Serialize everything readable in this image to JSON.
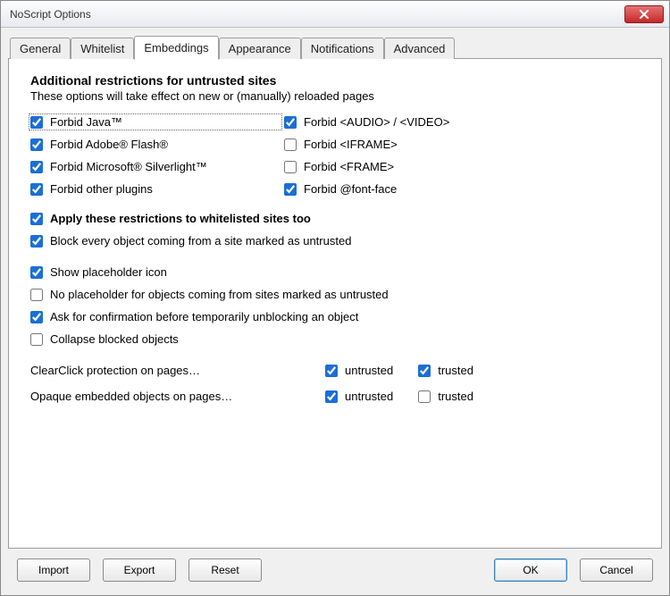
{
  "window": {
    "title": "NoScript Options"
  },
  "tabs": [
    "General",
    "Whitelist",
    "Embeddings",
    "Appearance",
    "Notifications",
    "Advanced"
  ],
  "panel": {
    "heading": "Additional restrictions for untrusted sites",
    "subheading": "These options will take effect on new or (manually) reloaded pages",
    "forbid": {
      "java": {
        "label": "Forbid Java™",
        "checked": true
      },
      "audio_video": {
        "label": "Forbid <AUDIO> / <VIDEO>",
        "checked": true
      },
      "flash": {
        "label": "Forbid Adobe® Flash®",
        "checked": true
      },
      "iframe": {
        "label": "Forbid <IFRAME>",
        "checked": false
      },
      "silverlight": {
        "label": "Forbid Microsoft® Silverlight™",
        "checked": true
      },
      "frame": {
        "label": "Forbid <FRAME>",
        "checked": false
      },
      "other_plugins": {
        "label": "Forbid other plugins",
        "checked": true
      },
      "font_face": {
        "label": "Forbid @font-face",
        "checked": true
      }
    },
    "options": {
      "apply_whitelisted": {
        "label": "Apply these restrictions to whitelisted sites too",
        "checked": true
      },
      "block_untrusted": {
        "label": "Block every object coming from a site marked as untrusted",
        "checked": true
      },
      "show_placeholder": {
        "label": "Show placeholder icon",
        "checked": true
      },
      "no_placeholder_untrusted": {
        "label": "No placeholder for objects coming from sites marked as untrusted",
        "checked": false
      },
      "ask_confirmation": {
        "label": "Ask for confirmation before temporarily unblocking an object",
        "checked": true
      },
      "collapse_blocked": {
        "label": "Collapse blocked objects",
        "checked": false
      }
    },
    "rows": {
      "clearclick": {
        "label": "ClearClick protection on pages…",
        "untrusted": {
          "label": "untrusted",
          "checked": true
        },
        "trusted": {
          "label": "trusted",
          "checked": true
        }
      },
      "opaque": {
        "label": "Opaque embedded objects on pages…",
        "untrusted": {
          "label": "untrusted",
          "checked": true
        },
        "trusted": {
          "label": "trusted",
          "checked": false
        }
      }
    }
  },
  "footer": {
    "import": "Import",
    "export": "Export",
    "reset": "Reset",
    "ok": "OK",
    "cancel": "Cancel"
  }
}
